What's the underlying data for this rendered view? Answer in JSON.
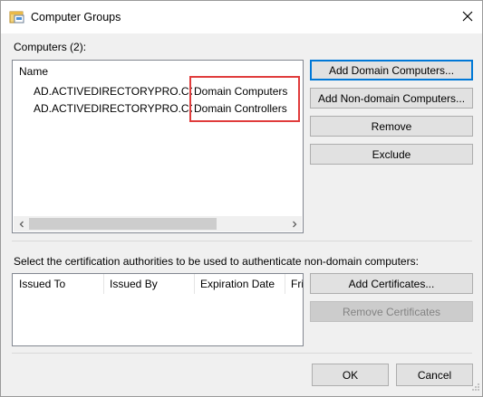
{
  "window": {
    "title": "Computer Groups"
  },
  "computers": {
    "label": "Computers (2):",
    "column_header": "Name",
    "rows": [
      {
        "domain": "AD.ACTIVEDIRECTORYPRO.COM\\",
        "group": "Domain Computers"
      },
      {
        "domain": "AD.ACTIVEDIRECTORYPRO.COM\\",
        "group": "Domain Controllers"
      }
    ],
    "buttons": {
      "add_domain": "Add Domain Computers...",
      "add_nondomain": "Add Non-domain Computers...",
      "remove": "Remove",
      "exclude": "Exclude"
    }
  },
  "certs": {
    "label": "Select the certification authorities to be used to authenticate non-domain computers:",
    "columns": [
      "Issued To",
      "Issued By",
      "Expiration Date",
      "Fri"
    ],
    "buttons": {
      "add": "Add Certificates...",
      "remove": "Remove Certificates"
    }
  },
  "footer": {
    "ok": "OK",
    "cancel": "Cancel"
  },
  "colors": {
    "accent": "#0078d7",
    "highlight": "#e03c3c"
  }
}
